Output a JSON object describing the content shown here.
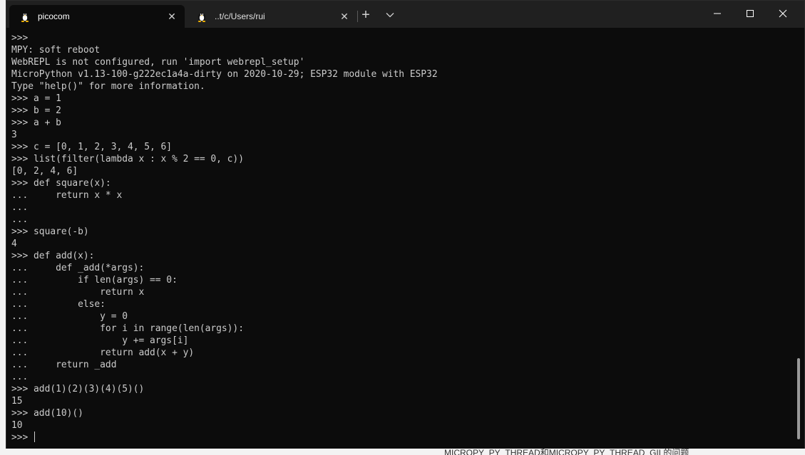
{
  "tabs": [
    {
      "title": "picocom",
      "icon": "linux-penguin-icon",
      "active": true
    },
    {
      "title": "..t/c/Users/rui",
      "icon": "linux-penguin-icon",
      "active": false
    }
  ],
  "titlebar": {
    "new_tab_glyph": "+",
    "close_tab_glyph": "✕"
  },
  "terminal": {
    "lines": [
      ">>>",
      "MPY: soft reboot",
      "WebREPL is not configured, run 'import webrepl_setup'",
      "MicroPython v1.13-100-g222ec1a4a-dirty on 2020-10-29; ESP32 module with ESP32",
      "Type \"help()\" for more information.",
      ">>> a = 1",
      ">>> b = 2",
      ">>> a + b",
      "3",
      ">>> c = [0, 1, 2, 3, 4, 5, 6]",
      ">>> list(filter(lambda x : x % 2 == 0, c))",
      "[0, 2, 4, 6]",
      ">>> def square(x):",
      "...     return x * x",
      "...",
      "...",
      ">>> square(-b)",
      "4",
      ">>> def add(x):",
      "...     def _add(*args):",
      "...         if len(args) == 0:",
      "...             return x",
      "...         else:",
      "...             y = 0",
      "...             for i in range(len(args)):",
      "...                 y += args[i]",
      "...             return add(x + y)",
      "...     return _add",
      "...",
      ">>> add(1)(2)(3)(4)(5)()",
      "15",
      ">>> add(10)()",
      "10"
    ],
    "prompt": ">>> "
  },
  "background": {
    "bottom_text": "MICROPY_PY_THREAD和MICROPY_PY_THREAD_GIL的问题"
  },
  "colors": {
    "terminal_bg": "#0c0c0c",
    "titlebar_bg": "#202020",
    "text": "#cccccc"
  }
}
